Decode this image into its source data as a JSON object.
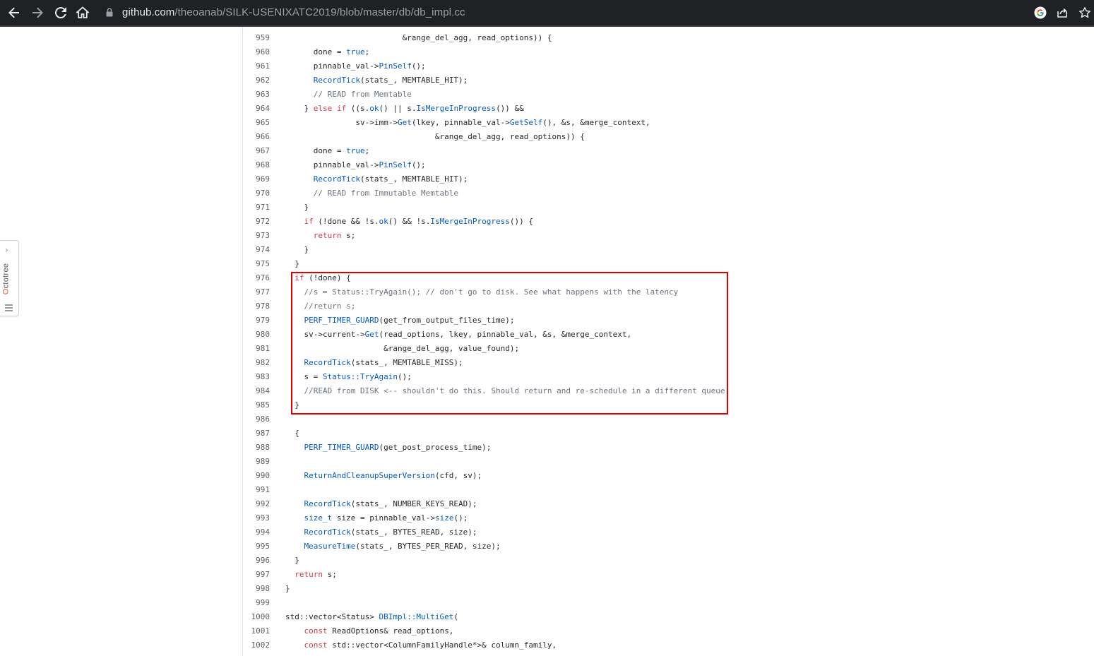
{
  "browser": {
    "url_host": "github.com",
    "url_path": "/theoanab/SILK-USENIXATC2019/blob/master/db/db_impl.cc",
    "icons": [
      "back-icon",
      "forward-icon",
      "reload-icon",
      "home-icon",
      "lock-icon",
      "google-icon",
      "share-icon",
      "star-icon"
    ]
  },
  "octotree": {
    "label_first": "O",
    "label_rest": "ctotree",
    "chevron": "›"
  },
  "code": {
    "lines": [
      {
        "n": "959",
        "parts": [
          {
            "t": "                         &range_del_agg, read_options)) {",
            "c": ""
          }
        ]
      },
      {
        "n": "960",
        "parts": [
          {
            "t": "      done = ",
            "c": ""
          },
          {
            "t": "true",
            "c": "fn"
          },
          {
            "t": ";",
            "c": ""
          }
        ]
      },
      {
        "n": "961",
        "parts": [
          {
            "t": "      pinnable_val->",
            "c": ""
          },
          {
            "t": "PinSelf",
            "c": "fn"
          },
          {
            "t": "();",
            "c": ""
          }
        ]
      },
      {
        "n": "962",
        "parts": [
          {
            "t": "      ",
            "c": ""
          },
          {
            "t": "RecordTick",
            "c": "fn"
          },
          {
            "t": "(stats_, MEMTABLE_HIT);",
            "c": ""
          }
        ]
      },
      {
        "n": "963",
        "parts": [
          {
            "t": "      // READ from Memtable",
            "c": "cm"
          }
        ]
      },
      {
        "n": "964",
        "parts": [
          {
            "t": "    } ",
            "c": ""
          },
          {
            "t": "else if",
            "c": "kw"
          },
          {
            "t": " ((s.",
            "c": ""
          },
          {
            "t": "ok",
            "c": "fn"
          },
          {
            "t": "() || s.",
            "c": ""
          },
          {
            "t": "IsMergeInProgress",
            "c": "fn"
          },
          {
            "t": "()) &&",
            "c": ""
          }
        ]
      },
      {
        "n": "965",
        "parts": [
          {
            "t": "               sv->imm->",
            "c": ""
          },
          {
            "t": "Get",
            "c": "fn"
          },
          {
            "t": "(lkey, pinnable_val->",
            "c": ""
          },
          {
            "t": "GetSelf",
            "c": "fn"
          },
          {
            "t": "(), &s, &merge_context,",
            "c": ""
          }
        ]
      },
      {
        "n": "966",
        "parts": [
          {
            "t": "                                &range_del_agg, read_options)) {",
            "c": ""
          }
        ]
      },
      {
        "n": "967",
        "parts": [
          {
            "t": "      done = ",
            "c": ""
          },
          {
            "t": "true",
            "c": "fn"
          },
          {
            "t": ";",
            "c": ""
          }
        ]
      },
      {
        "n": "968",
        "parts": [
          {
            "t": "      pinnable_val->",
            "c": ""
          },
          {
            "t": "PinSelf",
            "c": "fn"
          },
          {
            "t": "();",
            "c": ""
          }
        ]
      },
      {
        "n": "969",
        "parts": [
          {
            "t": "      ",
            "c": ""
          },
          {
            "t": "RecordTick",
            "c": "fn"
          },
          {
            "t": "(stats_, MEMTABLE_HIT);",
            "c": ""
          }
        ]
      },
      {
        "n": "970",
        "parts": [
          {
            "t": "      // READ from Immutable Memtable",
            "c": "cm"
          }
        ]
      },
      {
        "n": "971",
        "parts": [
          {
            "t": "    }",
            "c": ""
          }
        ]
      },
      {
        "n": "972",
        "parts": [
          {
            "t": "    ",
            "c": ""
          },
          {
            "t": "if",
            "c": "kw"
          },
          {
            "t": " (!done && !s.",
            "c": ""
          },
          {
            "t": "ok",
            "c": "fn"
          },
          {
            "t": "() && !s.",
            "c": ""
          },
          {
            "t": "IsMergeInProgress",
            "c": "fn"
          },
          {
            "t": "()) {",
            "c": ""
          }
        ]
      },
      {
        "n": "973",
        "parts": [
          {
            "t": "      ",
            "c": ""
          },
          {
            "t": "return",
            "c": "kw"
          },
          {
            "t": " s;",
            "c": ""
          }
        ]
      },
      {
        "n": "974",
        "parts": [
          {
            "t": "    }",
            "c": ""
          }
        ]
      },
      {
        "n": "975",
        "parts": [
          {
            "t": "  }",
            "c": ""
          }
        ]
      },
      {
        "n": "976",
        "parts": [
          {
            "t": "  ",
            "c": ""
          },
          {
            "t": "if",
            "c": "kw"
          },
          {
            "t": " (!done) {",
            "c": ""
          }
        ]
      },
      {
        "n": "977",
        "parts": [
          {
            "t": "    //s = Status::TryAgain(); // don't go to disk. See what happens with the latency",
            "c": "cm"
          }
        ]
      },
      {
        "n": "978",
        "parts": [
          {
            "t": "    //return s;",
            "c": "cm"
          }
        ]
      },
      {
        "n": "979",
        "parts": [
          {
            "t": "    ",
            "c": ""
          },
          {
            "t": "PERF_TIMER_GUARD",
            "c": "fn"
          },
          {
            "t": "(get_from_output_files_time);",
            "c": ""
          }
        ]
      },
      {
        "n": "980",
        "parts": [
          {
            "t": "    sv->current->",
            "c": ""
          },
          {
            "t": "Get",
            "c": "fn"
          },
          {
            "t": "(read_options, lkey, pinnable_val, &s, &merge_context,",
            "c": ""
          }
        ]
      },
      {
        "n": "981",
        "parts": [
          {
            "t": "                     &range_del_agg, value_found);",
            "c": ""
          }
        ]
      },
      {
        "n": "982",
        "parts": [
          {
            "t": "    ",
            "c": ""
          },
          {
            "t": "RecordTick",
            "c": "fn"
          },
          {
            "t": "(stats_, MEMTABLE_MISS);",
            "c": ""
          }
        ]
      },
      {
        "n": "983",
        "parts": [
          {
            "t": "    s = ",
            "c": ""
          },
          {
            "t": "Status::TryAgain",
            "c": "fn"
          },
          {
            "t": "();",
            "c": ""
          }
        ]
      },
      {
        "n": "984",
        "parts": [
          {
            "t": "    //READ from DISK <-- shouldn't do this. Should return and re-schedule in a different queue.",
            "c": "cm"
          }
        ]
      },
      {
        "n": "985",
        "parts": [
          {
            "t": "  }",
            "c": ""
          }
        ]
      },
      {
        "n": "986",
        "parts": [
          {
            "t": "",
            "c": ""
          }
        ]
      },
      {
        "n": "987",
        "parts": [
          {
            "t": "  {",
            "c": ""
          }
        ]
      },
      {
        "n": "988",
        "parts": [
          {
            "t": "    ",
            "c": ""
          },
          {
            "t": "PERF_TIMER_GUARD",
            "c": "fn"
          },
          {
            "t": "(get_post_process_time);",
            "c": ""
          }
        ]
      },
      {
        "n": "989",
        "parts": [
          {
            "t": "",
            "c": ""
          }
        ]
      },
      {
        "n": "990",
        "parts": [
          {
            "t": "    ",
            "c": ""
          },
          {
            "t": "ReturnAndCleanupSuperVersion",
            "c": "fn"
          },
          {
            "t": "(cfd, sv);",
            "c": ""
          }
        ]
      },
      {
        "n": "991",
        "parts": [
          {
            "t": "",
            "c": ""
          }
        ]
      },
      {
        "n": "992",
        "parts": [
          {
            "t": "    ",
            "c": ""
          },
          {
            "t": "RecordTick",
            "c": "fn"
          },
          {
            "t": "(stats_, NUMBER_KEYS_READ);",
            "c": ""
          }
        ]
      },
      {
        "n": "993",
        "parts": [
          {
            "t": "    ",
            "c": ""
          },
          {
            "t": "size_t",
            "c": "fn"
          },
          {
            "t": " size = pinnable_val->",
            "c": ""
          },
          {
            "t": "size",
            "c": "fn"
          },
          {
            "t": "();",
            "c": ""
          }
        ]
      },
      {
        "n": "994",
        "parts": [
          {
            "t": "    ",
            "c": ""
          },
          {
            "t": "RecordTick",
            "c": "fn"
          },
          {
            "t": "(stats_, BYTES_READ, size);",
            "c": ""
          }
        ]
      },
      {
        "n": "995",
        "parts": [
          {
            "t": "    ",
            "c": ""
          },
          {
            "t": "MeasureTime",
            "c": "fn"
          },
          {
            "t": "(stats_, BYTES_PER_READ, size);",
            "c": ""
          }
        ]
      },
      {
        "n": "996",
        "parts": [
          {
            "t": "  }",
            "c": ""
          }
        ]
      },
      {
        "n": "997",
        "parts": [
          {
            "t": "  ",
            "c": ""
          },
          {
            "t": "return",
            "c": "kw"
          },
          {
            "t": " s;",
            "c": ""
          }
        ]
      },
      {
        "n": "998",
        "parts": [
          {
            "t": "}",
            "c": ""
          }
        ]
      },
      {
        "n": "999",
        "parts": [
          {
            "t": "",
            "c": ""
          }
        ]
      },
      {
        "n": "1000",
        "parts": [
          {
            "t": "std::vector<Status> ",
            "c": ""
          },
          {
            "t": "DBImpl::MultiGet",
            "c": "fn"
          },
          {
            "t": "(",
            "c": ""
          }
        ]
      },
      {
        "n": "1001",
        "parts": [
          {
            "t": "    ",
            "c": ""
          },
          {
            "t": "const",
            "c": "kw"
          },
          {
            "t": " ReadOptions& read_options,",
            "c": ""
          }
        ]
      },
      {
        "n": "1002",
        "parts": [
          {
            "t": "    ",
            "c": ""
          },
          {
            "t": "const",
            "c": "kw"
          },
          {
            "t": " std::vector<ColumnFamilyHandle*>& column_family,",
            "c": ""
          }
        ]
      }
    ]
  }
}
